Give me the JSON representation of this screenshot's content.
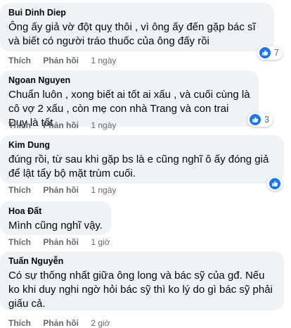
{
  "comments": [
    {
      "author": "Bui Dinh Diep",
      "text": "Ông ấy giả vờ đột quỵ thôi , vì ông ấy đến gặp bác sĩ và biết có người tráo thuốc của ông đấy rồi",
      "like_label": "Thích",
      "reply_label": "Phản hồi",
      "time": "1 ngày",
      "reaction": {
        "icon": "like-icon",
        "count": "7"
      }
    },
    {
      "author": "Ngoan Nguyen",
      "text": "Chuẩn luôn , xong biết ai tốt ai xấu , và cuối cùng là cô vợ 2 xấu , còn mẹ con nhà Trang và con trai Duy là tốt",
      "like_label": "Thích",
      "reply_label": "Phản hồi",
      "time": "1 ngày",
      "reaction": {
        "icon": "like-icon",
        "count": "3"
      }
    },
    {
      "author": "Kim Dung",
      "text": "đúng rồi, từ sau khi gặp bs là e cũng nghĩ ô ấy đóng giả để lật tẩy bộ mặt trùm cuối.",
      "like_label": "Thích",
      "reply_label": "Phản hồi",
      "time": "1 ngày",
      "reaction": {
        "icon": "like-icon",
        "count": ""
      }
    },
    {
      "author": "Hoa Đất",
      "text": "Mình cũng nghĩ vậy.",
      "like_label": "Thích",
      "reply_label": "Phản hồi",
      "time": "1 giờ"
    },
    {
      "author": "Tuấn Nguyễn",
      "text": "Có sự thống nhất giữa ông long và bác sỹ của gđ. Nếu ko khi duy nghi ngờ hỏi bác sỹ thì ko lý do gì bác sỹ phải giấu cả.",
      "like_label": "Thích",
      "reply_label": "Phản hồi",
      "time": "2 giờ"
    }
  ],
  "colors": {
    "bubble": "#f0f2f5",
    "like_blue": "#1877f2",
    "secondary_text": "#65676b"
  }
}
